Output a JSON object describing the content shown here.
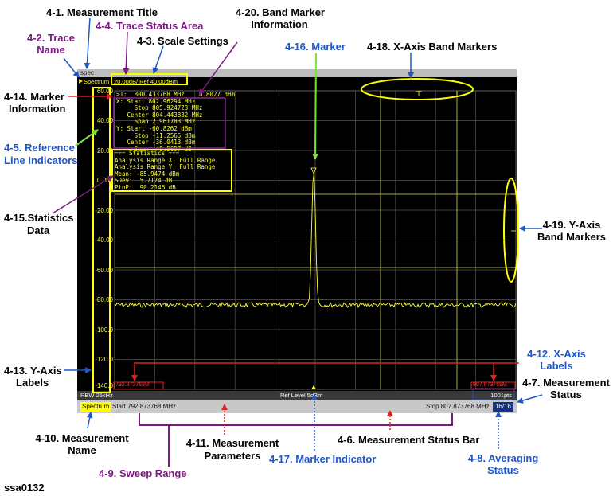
{
  "callouts": {
    "measurement_title": "4-1. Measurement Title",
    "trace_name_1": "4-2. Trace",
    "trace_name_2": "Name",
    "trace_status_area": "4-4. Trace Status Area",
    "scale_settings": "4-3. Scale Settings",
    "band_marker_info_1": "4-20. Band Marker",
    "band_marker_info_2": "Information",
    "marker": "4-16. Marker",
    "x_band_markers": "4-18. X-Axis Band Markers",
    "marker_info_1": "4-14. Marker",
    "marker_info_2": "Information",
    "ref_line_1": "4-5. Reference",
    "ref_line_2": "Line Indicators",
    "stats_1": "4-15.Statistics",
    "stats_2": "Data",
    "y_band_markers_1": "4-19. Y-Axis",
    "y_band_markers_2": "Band Markers",
    "y_axis_labels_1": "4-13. Y-Axis",
    "y_axis_labels_2": "Labels",
    "x_axis_labels_1": "4-12. X-Axis",
    "x_axis_labels_2": "Labels",
    "meas_status_1": "4-7. Measurement",
    "meas_status_2": "Status",
    "meas_name_1": "4-10. Measurement",
    "meas_name_2": "Name",
    "meas_params_1": "4-11. Measurement",
    "meas_params_2": "Parameters",
    "status_bar": "4-6. Measurement Status Bar",
    "sweep_range": "4-9. Sweep Range",
    "marker_indicator": "4-17. Marker Indicator",
    "averaging_1": "4-8. Averaging",
    "averaging_2": "Status",
    "figure_id": "ssa0132"
  },
  "screen": {
    "window_title": "spec",
    "trace_name": "Spectrum",
    "scale_settings": "20.00dB/ Ref 40.00dBm",
    "y_labels": [
      "60.00",
      "40.00",
      "20.00",
      "0.000",
      "-20.00",
      "-40.00",
      "-60.00",
      "-80.00",
      "-100.0",
      "-120.0",
      "-140.0"
    ],
    "marker_info": ">1:  800.433768 MHz    0.8027 dBm\nX: Start 802.96294 MHz\n     Stop 805.924723 MHz\n   Center 804.443832 MHz\n     Span 2.961783 MHz\nY: Start -60.8262 dBm\n     Stop -11.2565 dBm\n   Center -36.0413 dBm\n     Span  49.5697 dB",
    "stats_info": "=== Statistics ===\nAnalysis Range X: Full Range\nAnalysis Range Y: Full Range\nMean: -85.9474 dBm\nSDev:  5.7174 dB\nPtoP:  90.2146 dB",
    "x_label_start": "792.873768M",
    "x_label_stop": "807.873768M",
    "rbw": "RBW 25kHz",
    "ref_level": "Ref Level 5dBm",
    "points": "1001pts",
    "meas_name": "Spectrum",
    "sweep_start": "Start 792.873768 MHz",
    "sweep_stop": "Stop 807.873768 MHz",
    "avg_status": "16/16"
  },
  "colors": {
    "trace": "#ffff3a",
    "grid": "#555555",
    "callout_blue": "#1f57c6",
    "callout_purple": "#7a1a80",
    "highlight_yellow": "#ffff00",
    "x_label_red": "#e04848"
  }
}
